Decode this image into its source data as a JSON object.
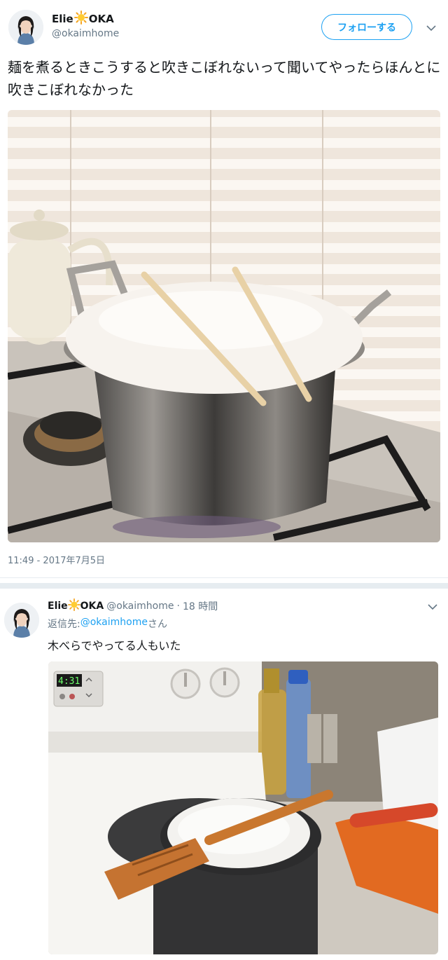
{
  "main_tweet": {
    "name_first": "Elie",
    "name_last": "OKA",
    "handle": "@okaimhome",
    "follow_label": "フォローする",
    "text": "麺を煮るときこうすると吹きこぼれないって聞いてやったらほんとに吹きこぼれなかった",
    "timestamp": "11:49 - 2017年7月5日",
    "photo_icon": "pot-with-chopsticks-photo"
  },
  "reply_tweet": {
    "name_first": "Elie",
    "name_last": "OKA",
    "handle": "@okaimhome",
    "separator": "·",
    "time": "18 時間",
    "reply_label": "返信先: ",
    "reply_handle": "@okaimhome",
    "reply_suffix": "さん",
    "text": "木べらでやってる人もいた",
    "photo_icon": "pot-with-wooden-spatula-photo",
    "stove_timer": "4:31"
  },
  "colors": {
    "accent": "#1da1f2",
    "secondary_text": "#657786",
    "primary_text": "#14171a"
  }
}
